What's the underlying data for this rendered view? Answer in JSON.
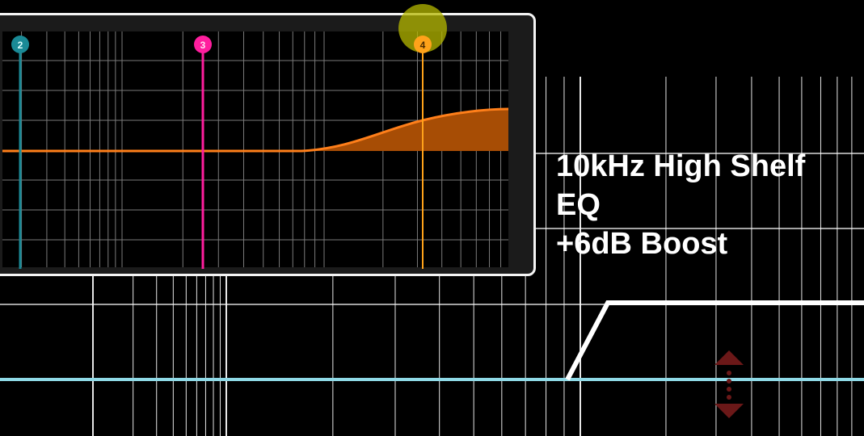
{
  "caption": {
    "line1": "10kHz High Shelf",
    "line2": "EQ",
    "line3": "+6dB Boost"
  },
  "eq_panel": {
    "bands": [
      {
        "label": "2",
        "color": "#1a8a96"
      },
      {
        "label": "3",
        "color": "#ff1e9e"
      },
      {
        "label": "4",
        "color": "#ffa21a"
      }
    ],
    "curve_color": "#ff7f1a",
    "fill_color": "#a74d05",
    "active_glow_color": "#b5b800"
  },
  "diagram": {
    "grid_color": "#ffffff",
    "baseline_color": "#8fd9e6",
    "shelf_color": "#ffffff",
    "handle_color": "#6b1818",
    "handle_icon": "vertical-drag-arrows-icon"
  }
}
